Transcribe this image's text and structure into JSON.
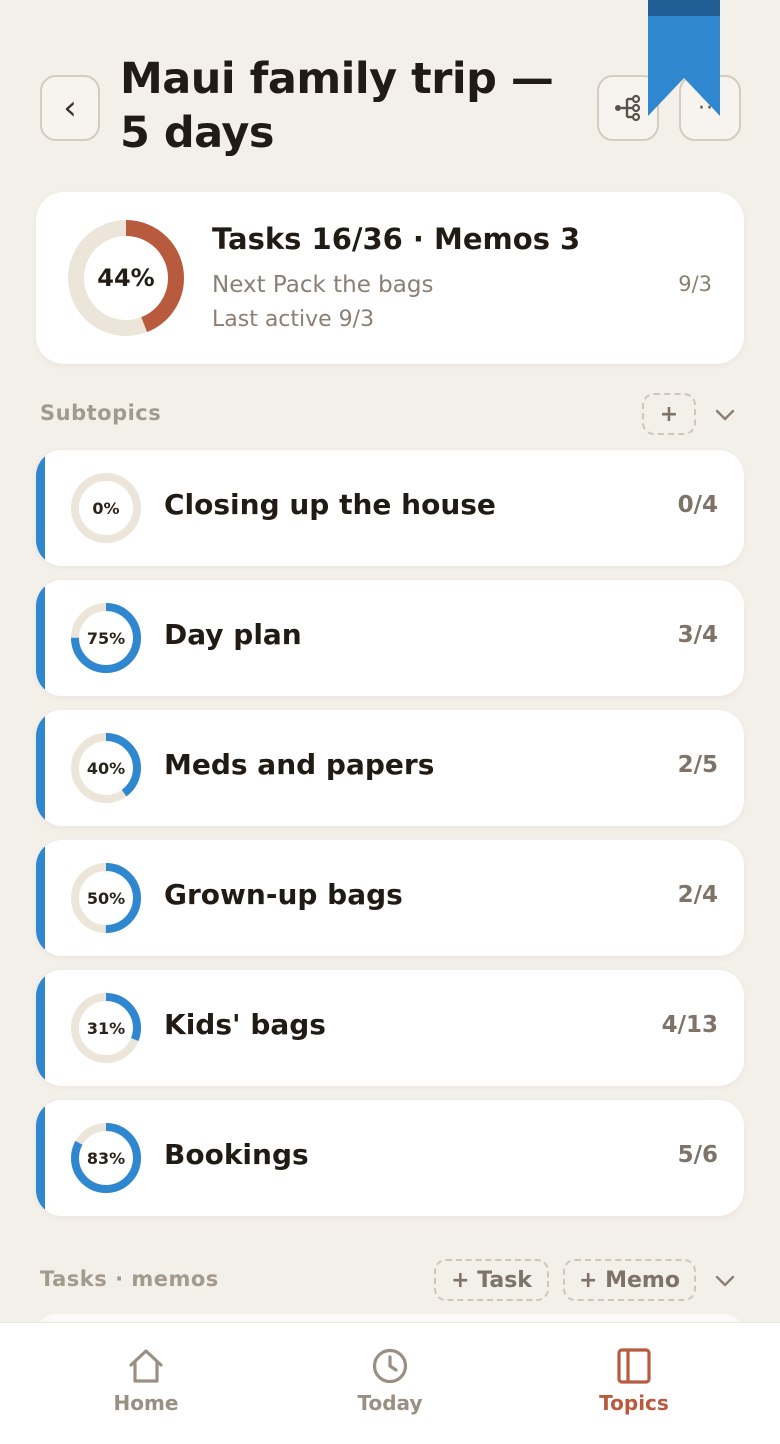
{
  "header": {
    "back_label": "‹",
    "title": "Maui family trip — 5 days",
    "more_label": "···"
  },
  "summary": {
    "progress_pct": 44,
    "progress_label": "44%",
    "title": "Tasks 16/36 · Memos 3",
    "next_line": "Next  Pack the bags",
    "next_date": "9/3",
    "last_active": "Last active 9/3"
  },
  "subtopics": {
    "label": "Subtopics",
    "add_label": "+",
    "items": [
      {
        "name": "Closing up the house",
        "pct": 0,
        "pct_label": "0%",
        "count": "0/4"
      },
      {
        "name": "Day plan",
        "pct": 75,
        "pct_label": "75%",
        "count": "3/4"
      },
      {
        "name": "Meds and papers",
        "pct": 40,
        "pct_label": "40%",
        "count": "2/5"
      },
      {
        "name": "Grown-up bags",
        "pct": 50,
        "pct_label": "50%",
        "count": "2/4"
      },
      {
        "name": "Kids' bags",
        "pct": 31,
        "pct_label": "31%",
        "count": "4/13"
      },
      {
        "name": "Bookings",
        "pct": 83,
        "pct_label": "83%",
        "count": "5/6"
      }
    ]
  },
  "tasks_memos": {
    "label": "Tasks · memos",
    "add_task_label": "+ Task",
    "add_memo_label": "+ Memo"
  },
  "tabbar": {
    "items": [
      {
        "label": "Home",
        "icon": "home-icon"
      },
      {
        "label": "Today",
        "icon": "clock-icon"
      },
      {
        "label": "Topics",
        "icon": "notebook-icon",
        "active": true
      }
    ]
  },
  "colors": {
    "background": "#f3efe9",
    "accent_blue": "#2f87d0",
    "accent_orange": "#b85a3e",
    "ring_track": "#ece5da",
    "bookmark_blue": "#2f87d0",
    "bookmark_dark": "#1f5d94"
  }
}
